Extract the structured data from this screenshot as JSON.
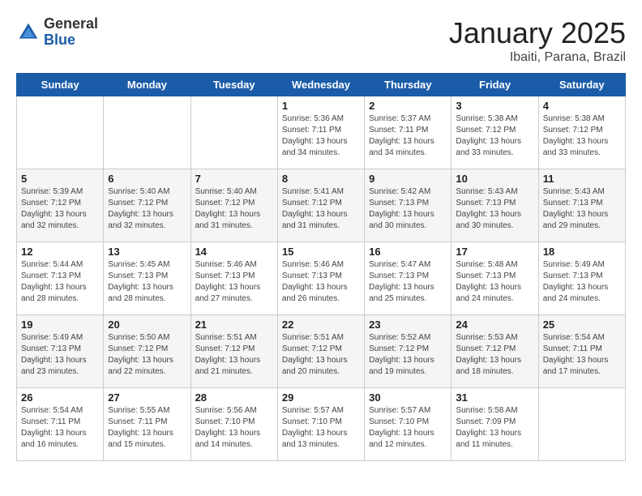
{
  "header": {
    "logo_general": "General",
    "logo_blue": "Blue",
    "title": "January 2025",
    "subtitle": "Ibaiti, Parana, Brazil"
  },
  "weekdays": [
    "Sunday",
    "Monday",
    "Tuesday",
    "Wednesday",
    "Thursday",
    "Friday",
    "Saturday"
  ],
  "weeks": [
    [
      {
        "day": "",
        "info": ""
      },
      {
        "day": "",
        "info": ""
      },
      {
        "day": "",
        "info": ""
      },
      {
        "day": "1",
        "info": "Sunrise: 5:36 AM\nSunset: 7:11 PM\nDaylight: 13 hours\nand 34 minutes."
      },
      {
        "day": "2",
        "info": "Sunrise: 5:37 AM\nSunset: 7:11 PM\nDaylight: 13 hours\nand 34 minutes."
      },
      {
        "day": "3",
        "info": "Sunrise: 5:38 AM\nSunset: 7:12 PM\nDaylight: 13 hours\nand 33 minutes."
      },
      {
        "day": "4",
        "info": "Sunrise: 5:38 AM\nSunset: 7:12 PM\nDaylight: 13 hours\nand 33 minutes."
      }
    ],
    [
      {
        "day": "5",
        "info": "Sunrise: 5:39 AM\nSunset: 7:12 PM\nDaylight: 13 hours\nand 32 minutes."
      },
      {
        "day": "6",
        "info": "Sunrise: 5:40 AM\nSunset: 7:12 PM\nDaylight: 13 hours\nand 32 minutes."
      },
      {
        "day": "7",
        "info": "Sunrise: 5:40 AM\nSunset: 7:12 PM\nDaylight: 13 hours\nand 31 minutes."
      },
      {
        "day": "8",
        "info": "Sunrise: 5:41 AM\nSunset: 7:12 PM\nDaylight: 13 hours\nand 31 minutes."
      },
      {
        "day": "9",
        "info": "Sunrise: 5:42 AM\nSunset: 7:13 PM\nDaylight: 13 hours\nand 30 minutes."
      },
      {
        "day": "10",
        "info": "Sunrise: 5:43 AM\nSunset: 7:13 PM\nDaylight: 13 hours\nand 30 minutes."
      },
      {
        "day": "11",
        "info": "Sunrise: 5:43 AM\nSunset: 7:13 PM\nDaylight: 13 hours\nand 29 minutes."
      }
    ],
    [
      {
        "day": "12",
        "info": "Sunrise: 5:44 AM\nSunset: 7:13 PM\nDaylight: 13 hours\nand 28 minutes."
      },
      {
        "day": "13",
        "info": "Sunrise: 5:45 AM\nSunset: 7:13 PM\nDaylight: 13 hours\nand 28 minutes."
      },
      {
        "day": "14",
        "info": "Sunrise: 5:46 AM\nSunset: 7:13 PM\nDaylight: 13 hours\nand 27 minutes."
      },
      {
        "day": "15",
        "info": "Sunrise: 5:46 AM\nSunset: 7:13 PM\nDaylight: 13 hours\nand 26 minutes."
      },
      {
        "day": "16",
        "info": "Sunrise: 5:47 AM\nSunset: 7:13 PM\nDaylight: 13 hours\nand 25 minutes."
      },
      {
        "day": "17",
        "info": "Sunrise: 5:48 AM\nSunset: 7:13 PM\nDaylight: 13 hours\nand 24 minutes."
      },
      {
        "day": "18",
        "info": "Sunrise: 5:49 AM\nSunset: 7:13 PM\nDaylight: 13 hours\nand 24 minutes."
      }
    ],
    [
      {
        "day": "19",
        "info": "Sunrise: 5:49 AM\nSunset: 7:13 PM\nDaylight: 13 hours\nand 23 minutes."
      },
      {
        "day": "20",
        "info": "Sunrise: 5:50 AM\nSunset: 7:12 PM\nDaylight: 13 hours\nand 22 minutes."
      },
      {
        "day": "21",
        "info": "Sunrise: 5:51 AM\nSunset: 7:12 PM\nDaylight: 13 hours\nand 21 minutes."
      },
      {
        "day": "22",
        "info": "Sunrise: 5:51 AM\nSunset: 7:12 PM\nDaylight: 13 hours\nand 20 minutes."
      },
      {
        "day": "23",
        "info": "Sunrise: 5:52 AM\nSunset: 7:12 PM\nDaylight: 13 hours\nand 19 minutes."
      },
      {
        "day": "24",
        "info": "Sunrise: 5:53 AM\nSunset: 7:12 PM\nDaylight: 13 hours\nand 18 minutes."
      },
      {
        "day": "25",
        "info": "Sunrise: 5:54 AM\nSunset: 7:11 PM\nDaylight: 13 hours\nand 17 minutes."
      }
    ],
    [
      {
        "day": "26",
        "info": "Sunrise: 5:54 AM\nSunset: 7:11 PM\nDaylight: 13 hours\nand 16 minutes."
      },
      {
        "day": "27",
        "info": "Sunrise: 5:55 AM\nSunset: 7:11 PM\nDaylight: 13 hours\nand 15 minutes."
      },
      {
        "day": "28",
        "info": "Sunrise: 5:56 AM\nSunset: 7:10 PM\nDaylight: 13 hours\nand 14 minutes."
      },
      {
        "day": "29",
        "info": "Sunrise: 5:57 AM\nSunset: 7:10 PM\nDaylight: 13 hours\nand 13 minutes."
      },
      {
        "day": "30",
        "info": "Sunrise: 5:57 AM\nSunset: 7:10 PM\nDaylight: 13 hours\nand 12 minutes."
      },
      {
        "day": "31",
        "info": "Sunrise: 5:58 AM\nSunset: 7:09 PM\nDaylight: 13 hours\nand 11 minutes."
      },
      {
        "day": "",
        "info": ""
      }
    ]
  ]
}
